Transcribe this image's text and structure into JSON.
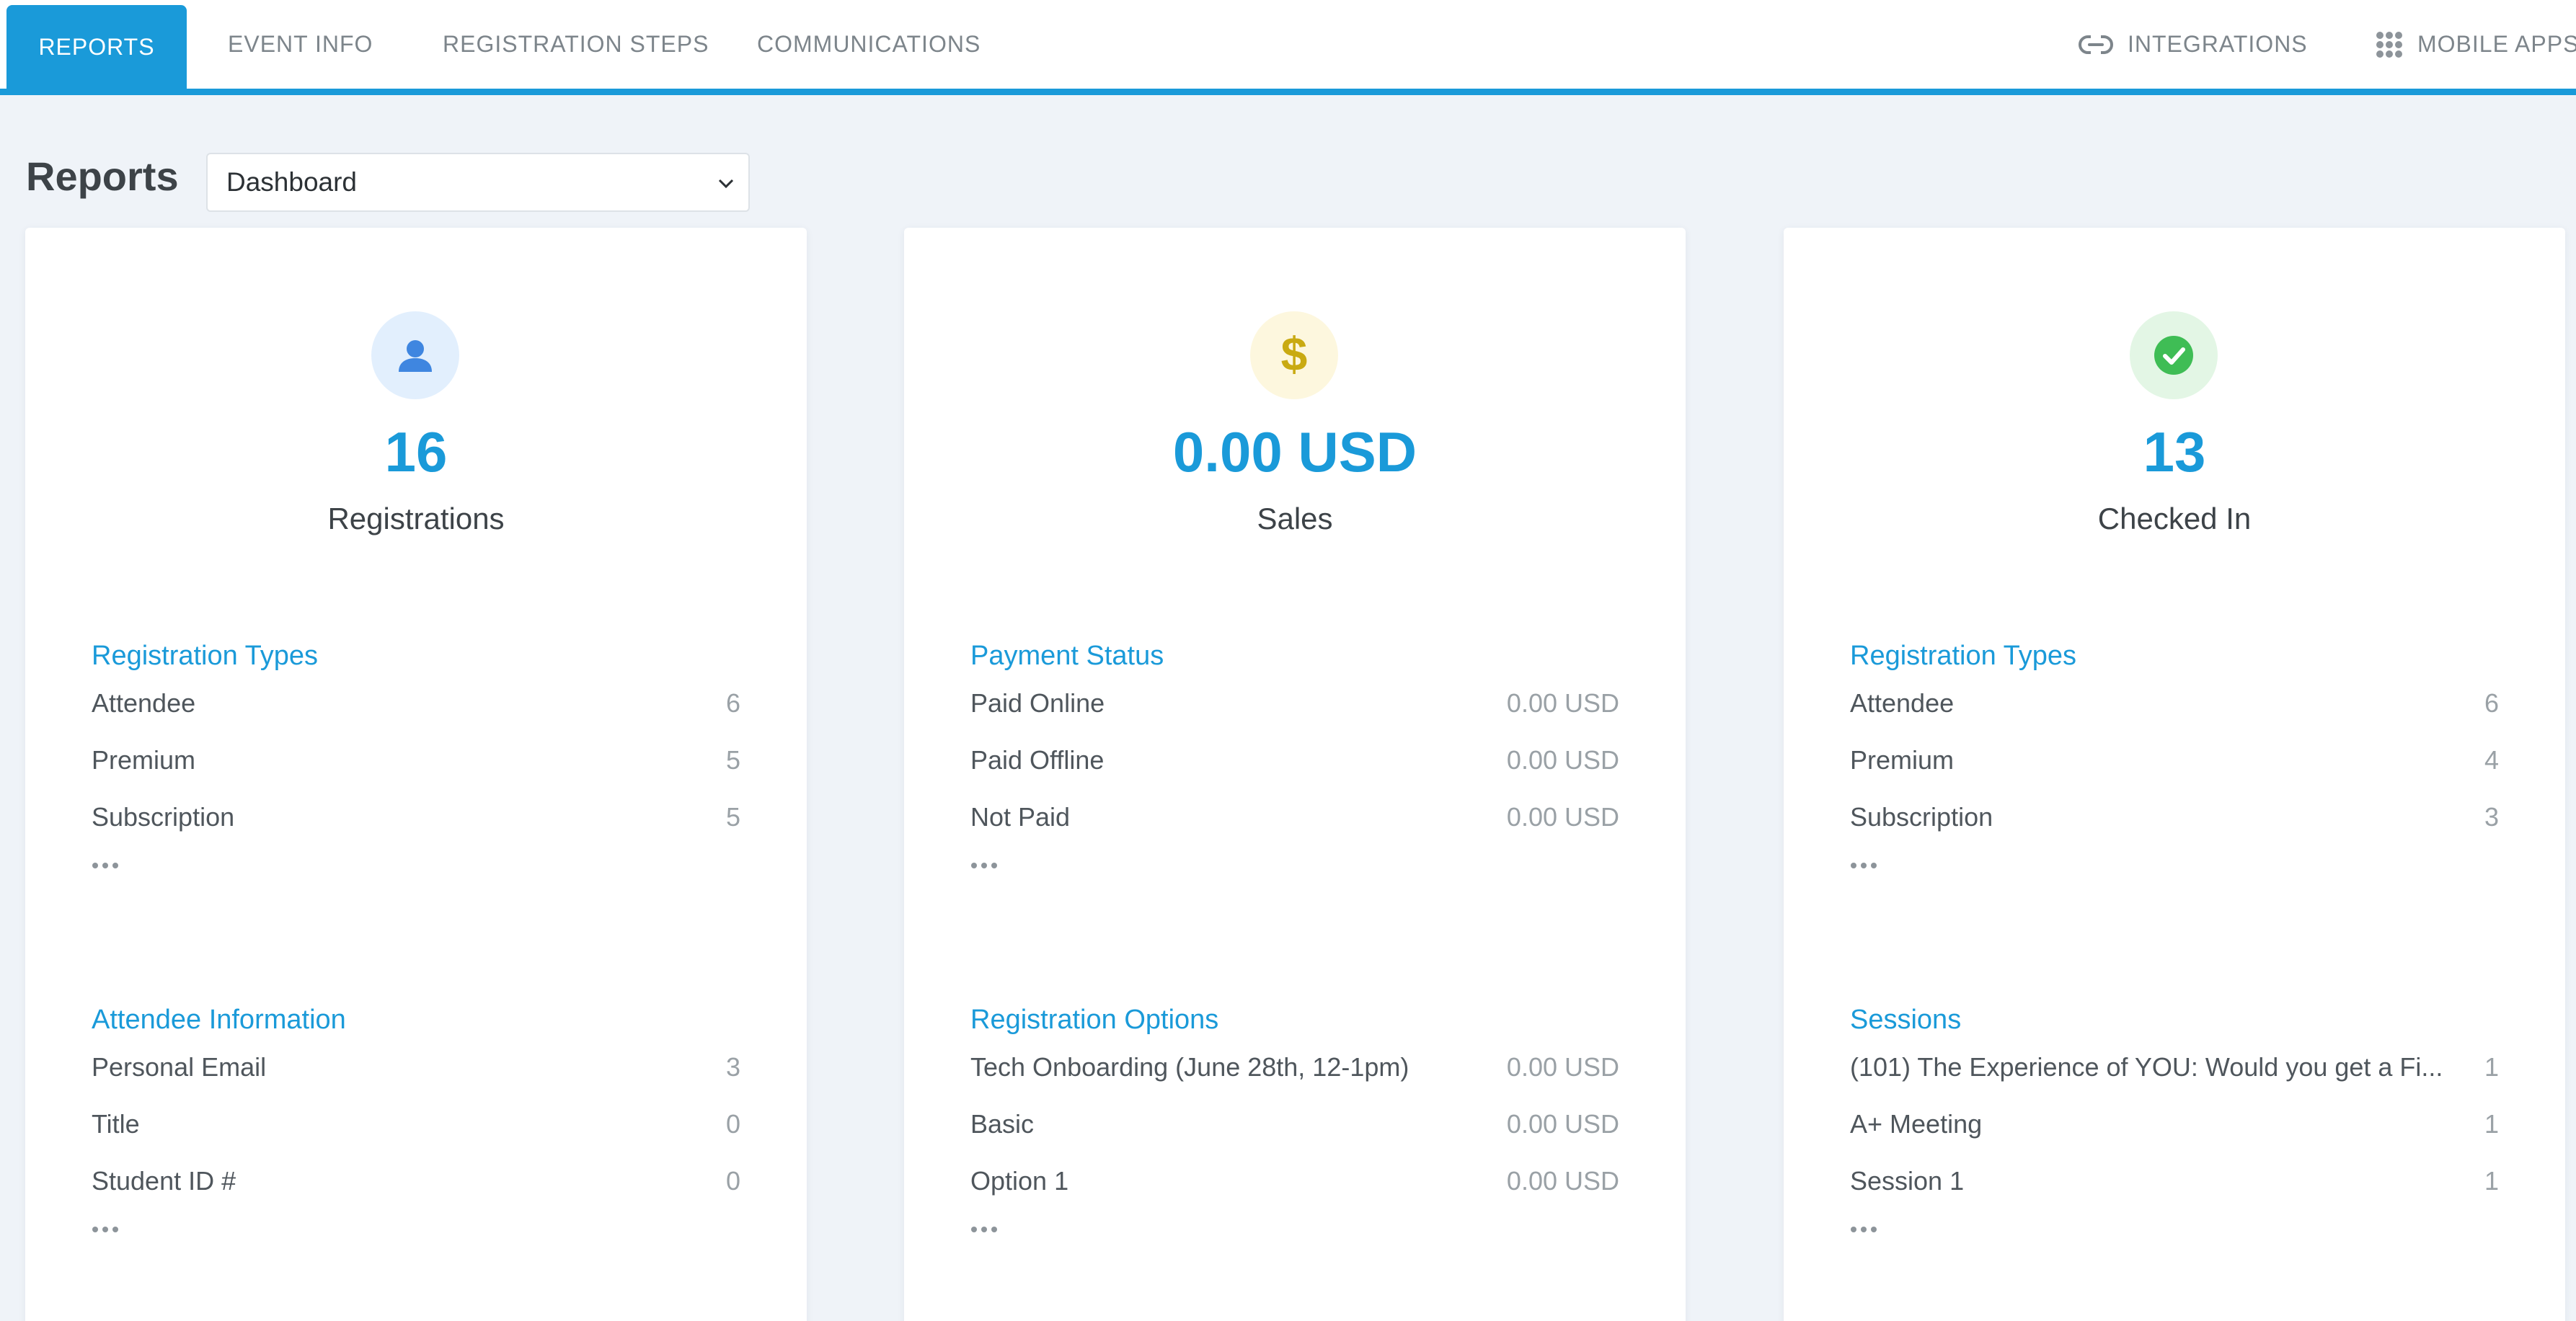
{
  "nav": {
    "tabs": [
      {
        "label": "REPORTS"
      },
      {
        "label": "EVENT INFO"
      },
      {
        "label": "REGISTRATION STEPS"
      },
      {
        "label": "COMMUNICATIONS"
      }
    ],
    "right": [
      {
        "label": "INTEGRATIONS",
        "icon": "link-icon"
      },
      {
        "label": "MOBILE APPS",
        "icon": "grid-icon"
      }
    ]
  },
  "header": {
    "title": "Reports",
    "select_value": "Dashboard"
  },
  "colors": {
    "accent": "#1a9ad9",
    "registrations_icon_bg": "#e2effd",
    "registrations_icon": "#3f86e0",
    "sales_icon_bg": "#fdf7de",
    "sales_icon": "#c9aa12",
    "checkin_icon_bg": "#e3f6e5",
    "checkin_icon": "#3fbd55"
  },
  "cards": [
    {
      "icon": "user-icon",
      "value": "16",
      "label": "Registrations",
      "sections": [
        {
          "title": "Registration Types",
          "rows": [
            {
              "label": "Attendee",
              "value": "6"
            },
            {
              "label": "Premium",
              "value": "5"
            },
            {
              "label": "Subscription",
              "value": "5"
            }
          ]
        },
        {
          "title": "Attendee Information",
          "rows": [
            {
              "label": "Personal Email",
              "value": "3"
            },
            {
              "label": "Title",
              "value": "0"
            },
            {
              "label": "Student ID #",
              "value": "0"
            }
          ]
        }
      ]
    },
    {
      "icon": "dollar-icon",
      "value": "0.00 USD",
      "label": "Sales",
      "sections": [
        {
          "title": "Payment Status",
          "rows": [
            {
              "label": "Paid Online",
              "value": "0.00 USD"
            },
            {
              "label": "Paid Offline",
              "value": "0.00 USD"
            },
            {
              "label": "Not Paid",
              "value": "0.00 USD"
            }
          ]
        },
        {
          "title": "Registration Options",
          "rows": [
            {
              "label": "Tech Onboarding (June 28th, 12-1pm)",
              "value": "0.00 USD"
            },
            {
              "label": "Basic",
              "value": "0.00 USD"
            },
            {
              "label": "Option 1",
              "value": "0.00 USD"
            }
          ]
        }
      ]
    },
    {
      "icon": "check-circle-icon",
      "value": "13",
      "label": "Checked In",
      "sections": [
        {
          "title": "Registration Types",
          "rows": [
            {
              "label": "Attendee",
              "value": "6"
            },
            {
              "label": "Premium",
              "value": "4"
            },
            {
              "label": "Subscription",
              "value": "3"
            }
          ]
        },
        {
          "title": "Sessions",
          "rows": [
            {
              "label": "(101) The Experience of YOU: Would you get a Fi...",
              "value": "1"
            },
            {
              "label": "A+ Meeting",
              "value": "1"
            },
            {
              "label": "Session 1",
              "value": "1"
            }
          ]
        }
      ]
    }
  ]
}
